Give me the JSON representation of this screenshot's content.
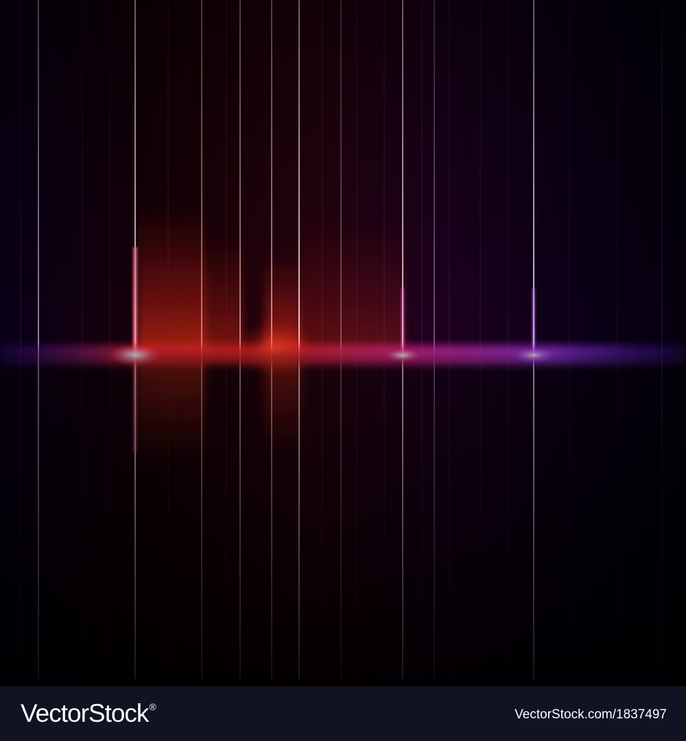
{
  "footer": {
    "brand_logo": "VectorStock",
    "brand_registered_mark": "®",
    "image_credit": "VectorStock.com/1837497"
  },
  "colors": {
    "background": "#050008",
    "footer_bar": "#0f1322",
    "red_glow": "#ff2a1a",
    "magenta_glow": "#ff2ca8",
    "violet_glow": "#b43cff",
    "line_white": "#ffffff"
  }
}
